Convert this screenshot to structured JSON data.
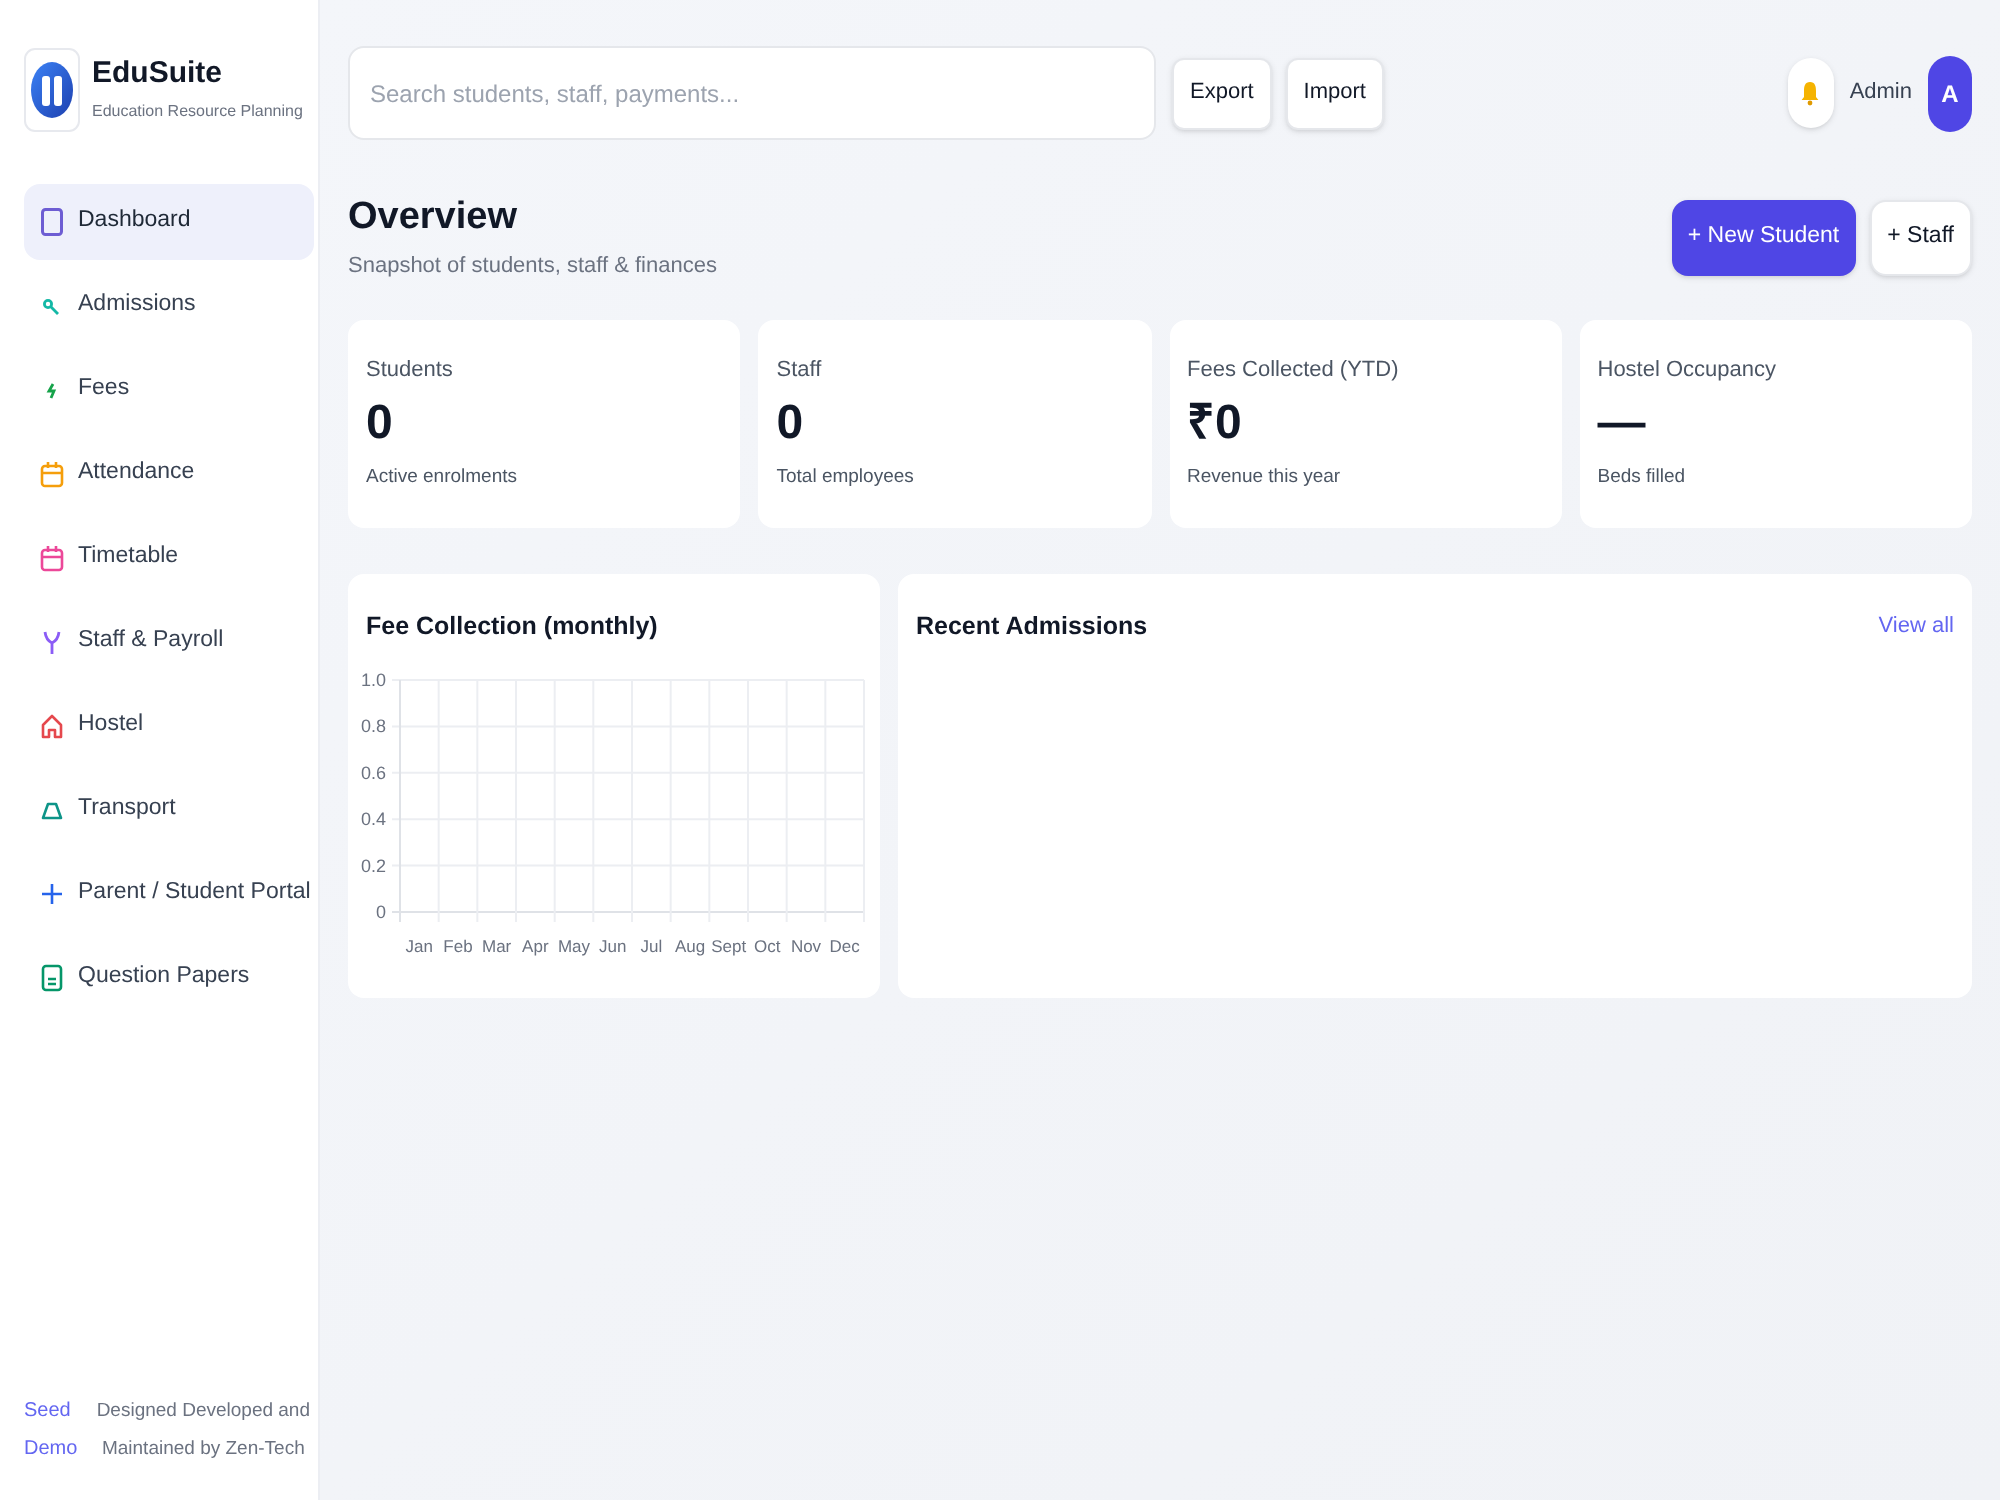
{
  "brand": {
    "name": "EduSuite",
    "tagline": "Education Resource Planning"
  },
  "sidebar": {
    "items": [
      {
        "label": "Dashboard",
        "selected": true
      },
      {
        "label": "Admissions",
        "selected": false
      },
      {
        "label": "Fees",
        "selected": false
      },
      {
        "label": "Attendance",
        "selected": false
      },
      {
        "label": "Timetable",
        "selected": false
      },
      {
        "label": "Staff & Payroll",
        "selected": false
      },
      {
        "label": "Hostel",
        "selected": false
      },
      {
        "label": "Transport",
        "selected": false
      },
      {
        "label": "Parent / Student Portal",
        "selected": false
      },
      {
        "label": "Question Papers",
        "selected": false
      }
    ],
    "footer": {
      "link": "Seed Demo",
      "credit": "Designed Developed and Maintained by Zen-Tech"
    }
  },
  "topbar": {
    "search": {
      "placeholder": "Search students, staff, payments..."
    },
    "buttons": [
      "Export",
      "Import"
    ],
    "user": "Admin",
    "avatar": "A"
  },
  "header": {
    "title": "Overview",
    "subtitle": "Snapshot of students, staff & finances",
    "actions": [
      {
        "label": "+ New Student",
        "kind": "primary"
      },
      {
        "label": "+ Staff",
        "kind": "secondary"
      }
    ]
  },
  "stats": [
    {
      "label": "Students",
      "value": "0",
      "note": "Active enrolments"
    },
    {
      "label": "Staff",
      "value": "0",
      "note": "Total employees"
    },
    {
      "label": "Fees Collected (YTD)",
      "value": "₹0",
      "note": "Revenue this year"
    },
    {
      "label": "Hostel Occupancy",
      "value": "—",
      "note": "Beds filled"
    }
  ],
  "fee_chart": {
    "chart_data": {
      "type": "bar",
      "title": "Fee Collection (monthly)",
      "categories": [
        "Jan",
        "Feb",
        "Mar",
        "Apr",
        "May",
        "Jun",
        "Jul",
        "Aug",
        "Sept",
        "Oct",
        "Nov",
        "Dec"
      ],
      "values": [
        null,
        null,
        null,
        null,
        null,
        null,
        null,
        null,
        null,
        null,
        null,
        null
      ],
      "ylim": [
        0,
        1
      ],
      "yticks": [
        0,
        0.2,
        0.4,
        0.6,
        0.8,
        {
          "value": 1,
          "label": "1.0"
        }
      ],
      "grid": true
    }
  },
  "recent_admissions": {
    "title": "Recent Admissions",
    "link": "View all"
  }
}
